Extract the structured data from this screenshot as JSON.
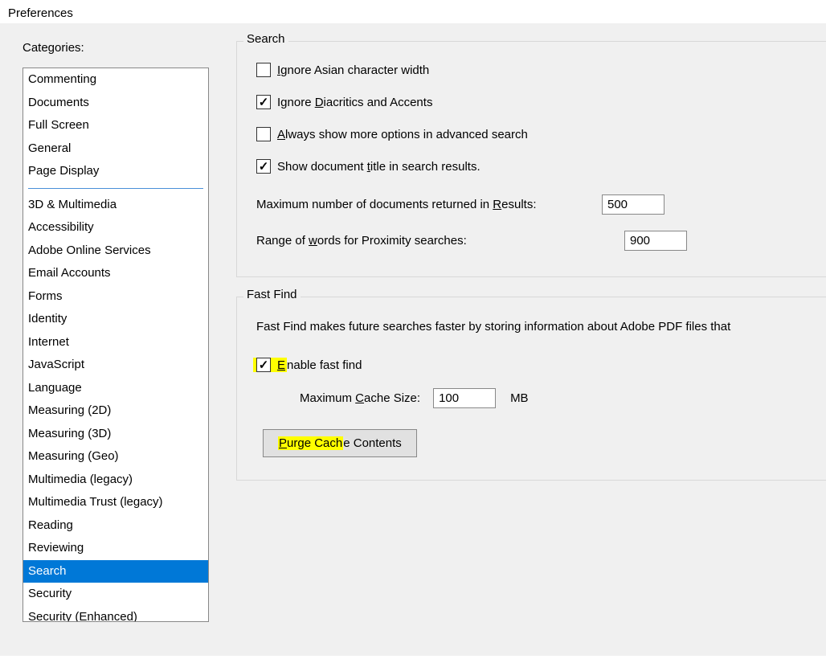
{
  "window": {
    "title": "Preferences"
  },
  "categories": {
    "label": "Categories:",
    "group1": [
      "Commenting",
      "Documents",
      "Full Screen",
      "General",
      "Page Display"
    ],
    "group2": [
      "3D & Multimedia",
      "Accessibility",
      "Adobe Online Services",
      "Email Accounts",
      "Forms",
      "Identity",
      "Internet",
      "JavaScript",
      "Language",
      "Measuring (2D)",
      "Measuring (3D)",
      "Measuring (Geo)",
      "Multimedia (legacy)",
      "Multimedia Trust (legacy)",
      "Reading",
      "Reviewing",
      "Search",
      "Security",
      "Security (Enhanced)"
    ],
    "selected": "Search"
  },
  "search_group": {
    "legend": "Search",
    "ignore_asian": {
      "label_pre": "",
      "label_u": "I",
      "label_post": "gnore Asian character width",
      "checked": false
    },
    "ignore_diacritics": {
      "label_pre": "Ignore ",
      "label_u": "D",
      "label_post": "iacritics and Accents",
      "checked": true
    },
    "always_show": {
      "label_pre": "",
      "label_u": "A",
      "label_post": "lways show more options in advanced search",
      "checked": false
    },
    "show_title": {
      "label_pre": "Show document ",
      "label_u": "t",
      "label_post": "itle in search results.",
      "checked": true
    },
    "max_results": {
      "label_pre": "Maximum number of documents returned in ",
      "label_u": "R",
      "label_post": "esults:",
      "value": "500"
    },
    "proximity": {
      "label_pre": "Range of ",
      "label_u": "w",
      "label_post": "ords for Proximity searches:",
      "value": "900"
    }
  },
  "fast_find_group": {
    "legend": "Fast Find",
    "description": "Fast Find makes future searches faster by storing information about Adobe PDF files that",
    "enable": {
      "label_pre": "",
      "label_u": "E",
      "label_post": "nable fast find",
      "checked": true
    },
    "cache_size": {
      "label_pre": "Maximum ",
      "label_u": "C",
      "label_post": "ache Size:",
      "value": "100",
      "unit": "MB"
    },
    "purge_button": {
      "pre": "",
      "u": "P",
      "mid_hl": "urge Cach",
      "post": "e Contents"
    }
  }
}
